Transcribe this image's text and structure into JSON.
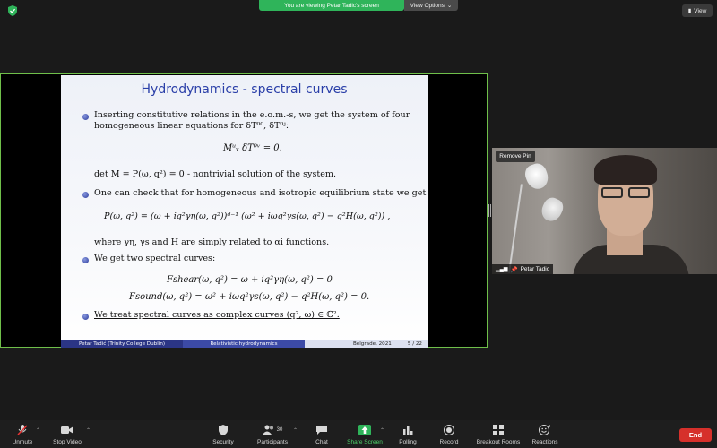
{
  "top": {
    "viewing_banner": "You are viewing Petar Tadic's screen",
    "view_options": "View Options",
    "view_button": "View"
  },
  "slide": {
    "title": "Hydrodynamics - spectral curves",
    "b1_line1": "Inserting constitutive relations in the e.o.m.-s, we get the system of four",
    "b1_line2": "homogeneous linear equations for δT⁰⁰, δT⁰ʲ:",
    "eq1": "Mᵘᵥ δT⁰ᵛ = 0.",
    "det_line": "det M = P(ω, q²) = 0 - nontrivial solution of the system.",
    "b2_line": "One can check that for homogeneous and isotropic equilibrium state we get",
    "eq2": "P(ω, q²) = (ω + iq²γη(ω, q²))ᵈ⁻¹ (ω² + iωq²γs(ω, q²) − q²H(ω, q²)) ,",
    "where_line": "where γη, γs and H are simply related to αi functions.",
    "b3_line": "We get two spectral curves:",
    "eq3": "Fshear(ω, q²) = ω + iq²γη(ω, q²) = 0",
    "eq4": "Fsound(ω, q²) = ω² + iωq²γs(ω, q²) − q²H(ω, q²) = 0.",
    "b4_line": "We treat spectral curves as complex curves (q², ω) ∈ ℂ².",
    "footer_author": "Petar Tadić (Trinity College Dublin)",
    "footer_title": "Relativistic hydrodynamics",
    "footer_place": "Belgrade, 2021",
    "footer_page": "5 / 22"
  },
  "video": {
    "remove_pin": "Remove Pin",
    "participant_name": "Petar Tadic"
  },
  "toolbar": {
    "unmute": "Unmute",
    "stop_video": "Stop Video",
    "security": "Security",
    "participants": "Participants",
    "participants_count": "30",
    "chat": "Chat",
    "share_screen": "Share Screen",
    "polling": "Polling",
    "record": "Record",
    "breakout_rooms": "Breakout Rooms",
    "reactions": "Reactions",
    "end": "End"
  },
  "colors": {
    "share_border": "#6fbf4a",
    "banner": "#2fb45a",
    "end_button": "#d6302b",
    "slide_title": "#2a3fa8"
  }
}
